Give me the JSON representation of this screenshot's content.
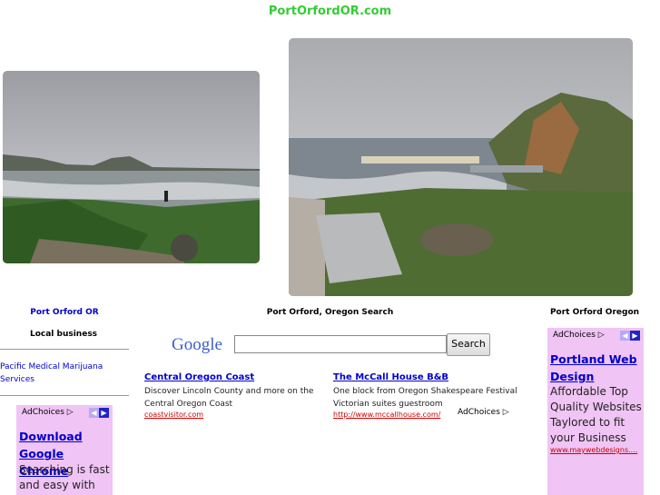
{
  "header": {
    "site_title": "PortOrfordOR.com"
  },
  "left": {
    "heading": "Port Orford OR",
    "subheading": "Local business",
    "link": "Pacific Medical Marijuana Services",
    "ad": {
      "adchoices": "AdChoices",
      "headline": "Download Google Chrome",
      "body": "Searching is fast and easy with"
    }
  },
  "center": {
    "heading": "Port Orford, Oregon Search",
    "google_logo": "Google",
    "search_input_value": "",
    "search_button": "Search",
    "results": [
      {
        "title": "Central Oregon Coast",
        "desc": "Discover Lincoln County and more on the Central Oregon Coast",
        "url": "coastvisitor.com"
      },
      {
        "title": "The McCall House B&B",
        "desc": "One block from Oregon Shakespeare Festival Victorian suites guestroom",
        "url": "http://www.mccallhouse.com/"
      }
    ],
    "adchoices": "AdChoices"
  },
  "right": {
    "heading": "Port Orford Oregon",
    "ad": {
      "adchoices": "AdChoices",
      "headline": "Portland Web Design",
      "body": "Affordable Top Quality Websites Taylored to fit your Business",
      "url": "www.maywebdesigns...."
    }
  },
  "colors": {
    "title_green": "#33cc33",
    "ad_bg": "#f0c4f4",
    "link_blue": "#0000cc",
    "url_red": "#cc0000"
  }
}
